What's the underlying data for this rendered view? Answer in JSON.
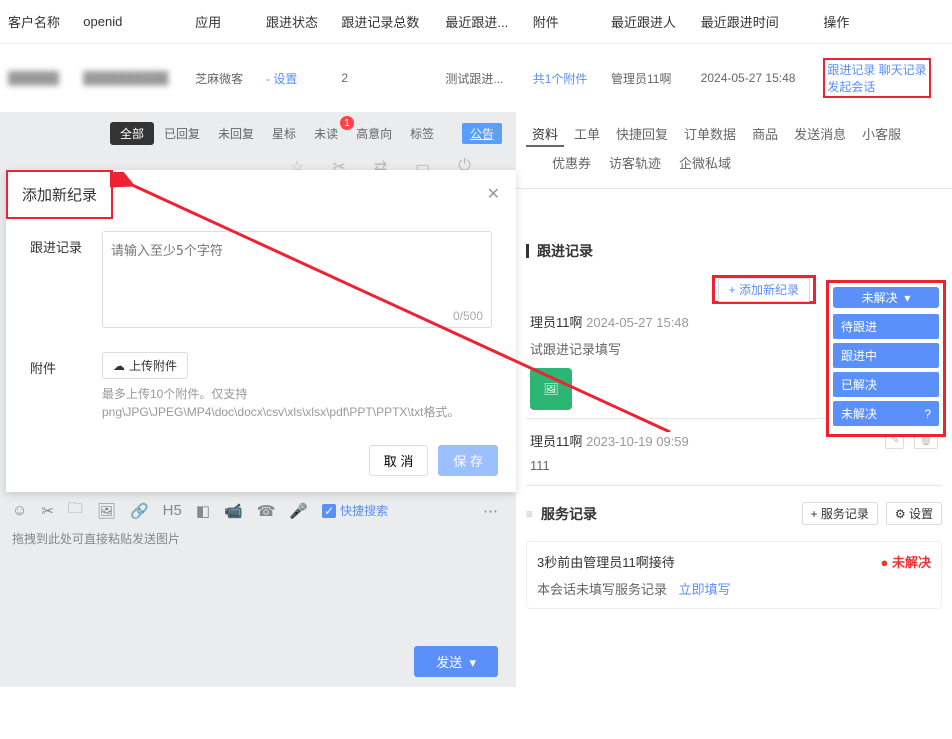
{
  "table": {
    "headers": [
      "客户名称",
      "openid",
      "应用",
      "跟进状态",
      "跟进记录总数",
      "最近跟进...",
      "附件",
      "最近跟进人",
      "最近跟进时间",
      "操作"
    ],
    "row": {
      "customer": "██████",
      "openid": "██████████",
      "app": "芝麻微客",
      "status": "- 设置",
      "count": "2",
      "lastFollow": "测试跟进...",
      "attachment": "共1个附件",
      "followBy": "管理员11啊",
      "time": "2024-05-27 15:48",
      "op1": "跟进记录",
      "op2": "聊天记录",
      "op3": "发起会话"
    }
  },
  "leftToolbar": {
    "all": "全部",
    "replied": "已回复",
    "unread": "未回复",
    "star": "星标",
    "unreadMsg": "未读",
    "high": "高意向",
    "tag": "标签"
  },
  "announce": "公告",
  "rightTabs": {
    "t1": "资料",
    "t2": "工单",
    "t3": "快捷回复",
    "t4": "订单数据",
    "t5": "商品",
    "t6": "发送消息",
    "t7": "小客服",
    "l2a": "优惠券",
    "l2b": "访客轨迹",
    "l2c": "企微私域"
  },
  "followSection": {
    "title": "跟进记录",
    "addBtn": "+ 添加新纪录",
    "statusTrigger": "未解决",
    "options": [
      "待跟进",
      "跟进中",
      "已解决",
      "未解决"
    ],
    "rec1_who": "理员11啊",
    "rec1_when": "2024-05-27 15:48",
    "rec1_txt": "试跟进记录填写",
    "rec2_who": "理员11啊",
    "rec2_when": "2023-10-19 09:59",
    "rec2_txt": "111"
  },
  "svcSection": {
    "title": "服务记录",
    "addBtn": "+ 服务记录",
    "settingBtn": "设置",
    "line1": "3秒前由管理员11啊接待",
    "badge": "未解决",
    "line2a": "本会话未填写服务记录",
    "line2b": "立即填写"
  },
  "modal": {
    "title": "添加新纪录",
    "labelFollow": "跟进记录",
    "placeholder": "请输入至少5个字符",
    "counter": "0/500",
    "labelAttach": "附件",
    "uploadBtn": "上传附件",
    "hint": "最多上传10个附件。仅支持png\\JPG\\JPEG\\MP4\\doc\\docx\\csv\\xls\\xlsx\\pdf\\PPT\\PPTX\\txt格式。",
    "cancel": "取 消",
    "save": "保 存"
  },
  "editor": {
    "quickSearch": "快捷搜索",
    "dropHint": "拖拽到此处可直接粘贴发送图片",
    "send": "发送"
  }
}
